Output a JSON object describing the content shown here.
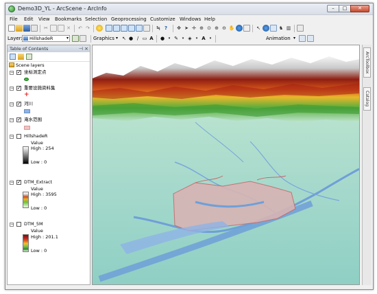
{
  "window": {
    "title": "Demo3D_YL - ArcScene - ArcInfo",
    "minimize": "–",
    "maximize": "□",
    "close": "✕"
  },
  "menu": [
    "File",
    "Edit",
    "View",
    "Bookmarks",
    "Selection",
    "Geoprocessing",
    "Customize",
    "Windows",
    "Help"
  ],
  "toolbar": {
    "layer_label": "Layer:",
    "layer_value": "HillshadeR",
    "graphics_label": "Graphics",
    "animation_label": "Animation"
  },
  "toc": {
    "title": "Table of Contents",
    "scene_layers": "Scene layers",
    "layers": [
      {
        "name": "坐标测定点",
        "checked": true,
        "symbol": "green-circle",
        "color": "#3cc33c"
      },
      {
        "name": "重要设施资料集",
        "checked": true,
        "symbol": "red-cross",
        "color": "#e02020"
      },
      {
        "name": "河川",
        "checked": true,
        "symbol": "blue-rect",
        "color": "#8fb3e6"
      },
      {
        "name": "淹水范围",
        "checked": true,
        "symbol": "pink-rect",
        "color": "#f2c2c2"
      },
      {
        "name": "HillshadeR",
        "checked": false,
        "value_label": "Value",
        "high": "High : 254",
        "low": "Low : 0"
      },
      {
        "name": "DTM_Extract",
        "checked": true,
        "value_label": "Value",
        "high": "High : 3595",
        "low": "Low : 0"
      },
      {
        "name": "DTM_5M",
        "checked": false,
        "value_label": "Value",
        "high": "High : 201.1",
        "low": "Low : 0"
      }
    ]
  },
  "side_tabs": {
    "toolbox": "ArcToolbox",
    "catalog": "Catalog"
  }
}
